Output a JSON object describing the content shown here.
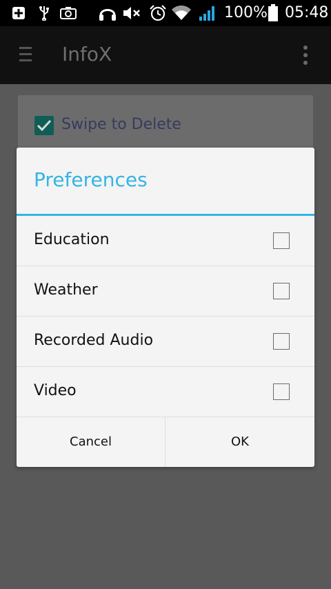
{
  "status_bar": {
    "battery": "100%",
    "time": "05:48",
    "icons": [
      "plus-icon",
      "usb-icon",
      "screenshot-icon",
      "headphones-icon",
      "mute-icon",
      "alarm-icon",
      "wifi-icon",
      "signal-icon",
      "battery-icon"
    ]
  },
  "app_bar": {
    "title": "InfoX",
    "icons": [
      "menu-icon",
      "overflow-menu-icon"
    ]
  },
  "background": {
    "swipe_label": "Swipe to Delete",
    "swipe_checked": true,
    "accent": "#0f5e55"
  },
  "dialog": {
    "title": "Preferences",
    "accent": "#33b5e5",
    "items": [
      {
        "label": "Education",
        "checked": false
      },
      {
        "label": "Weather",
        "checked": false
      },
      {
        "label": "Recorded Audio",
        "checked": false
      },
      {
        "label": "Video",
        "checked": false
      }
    ],
    "cancel_label": "Cancel",
    "ok_label": "OK"
  }
}
